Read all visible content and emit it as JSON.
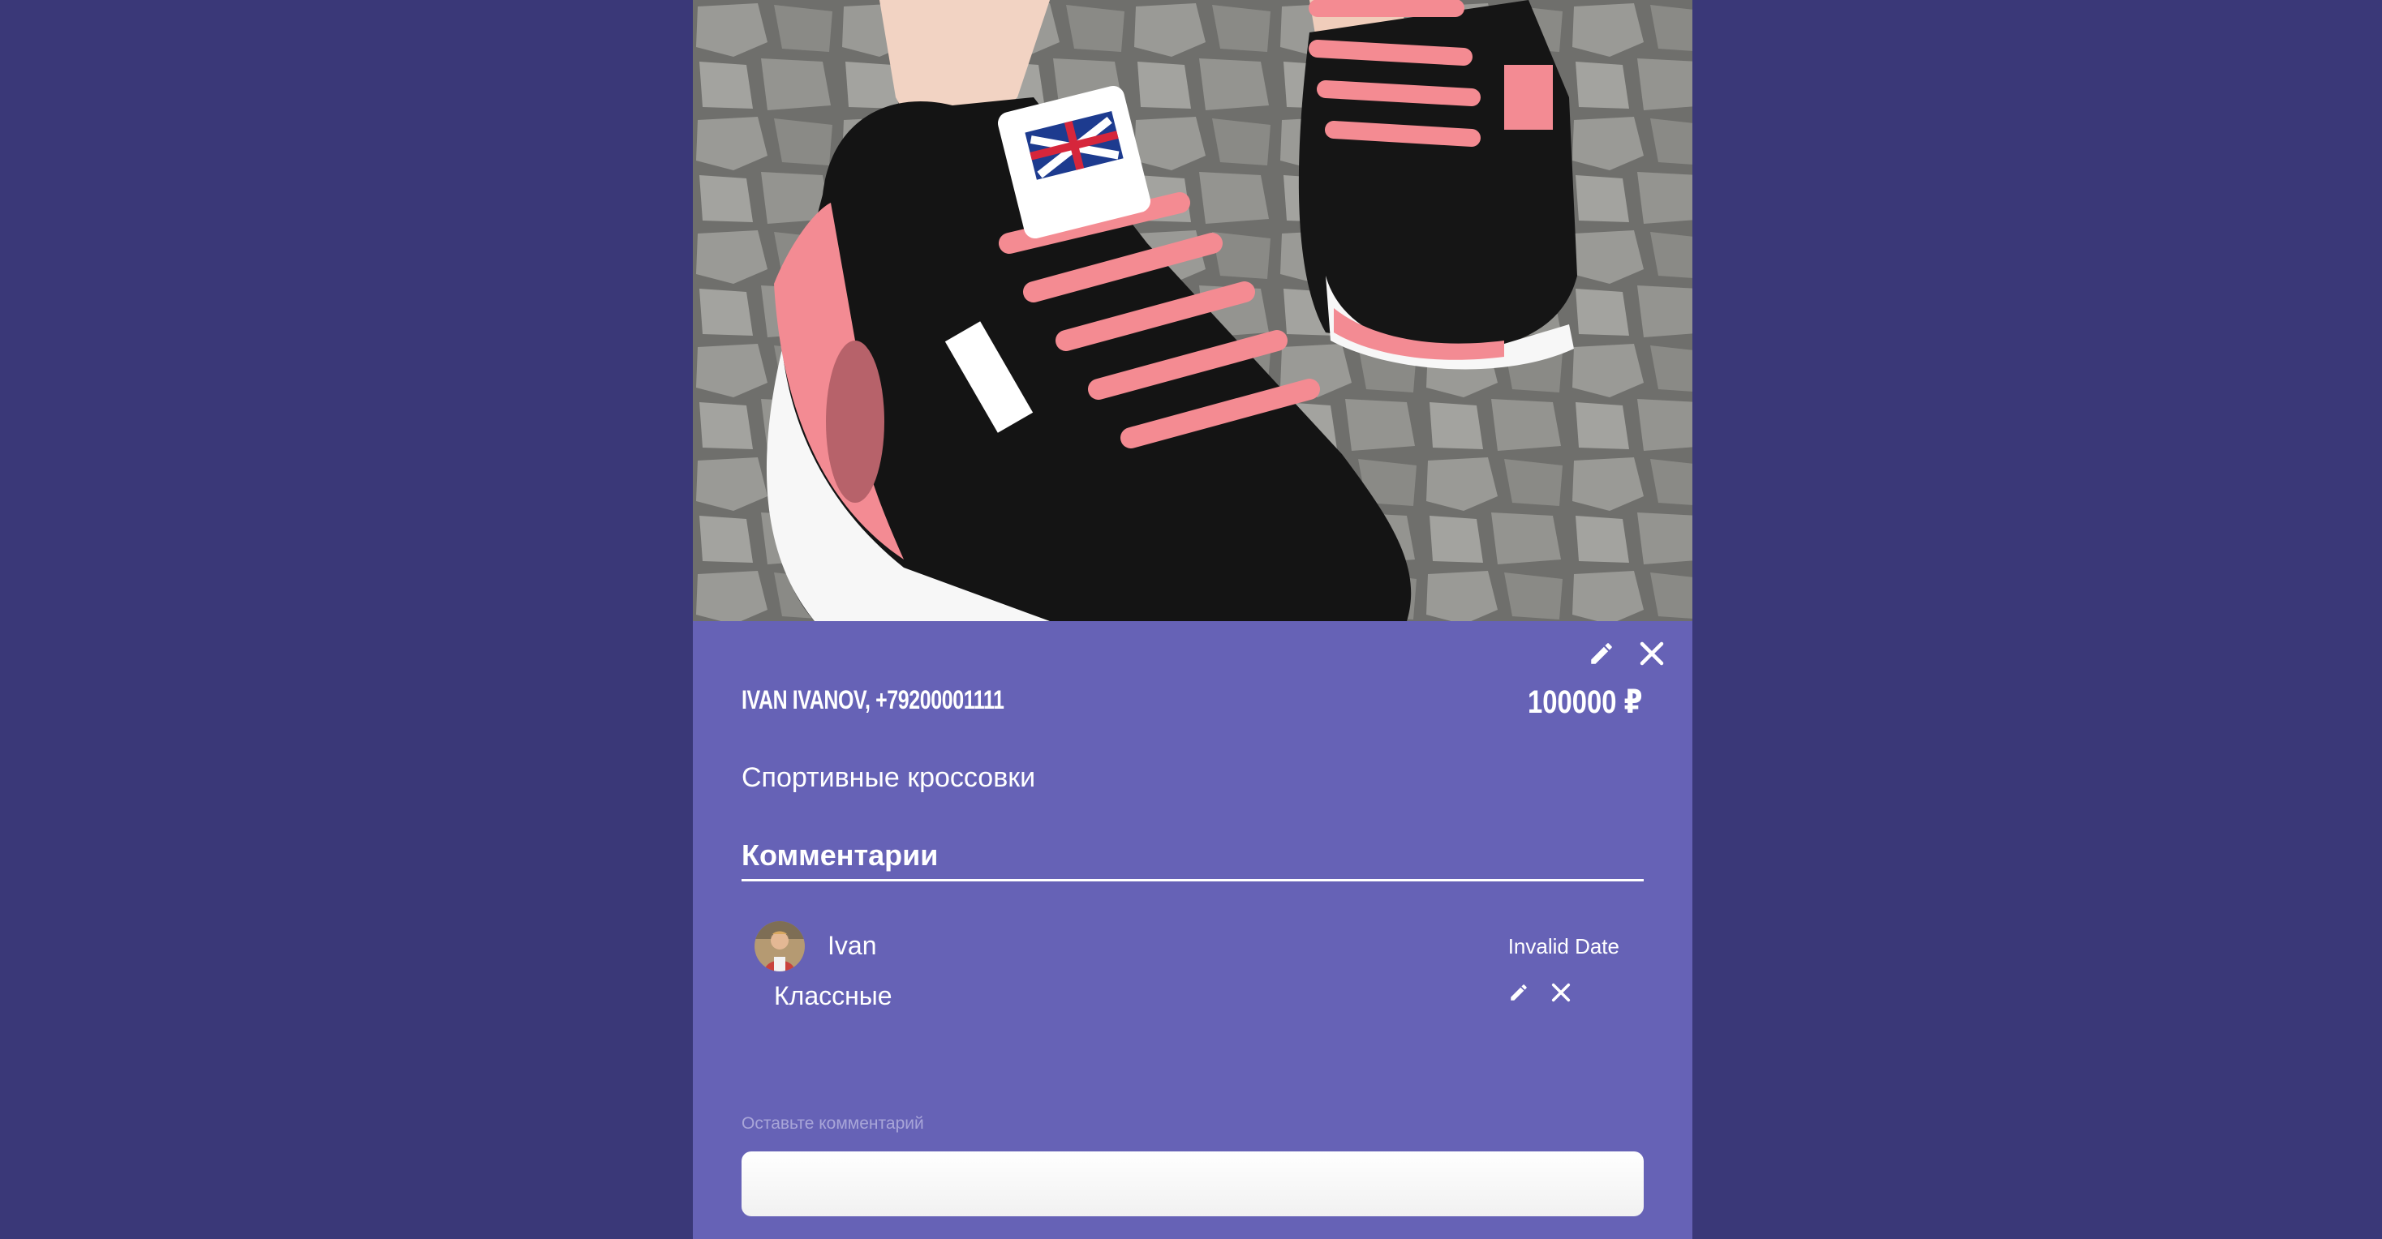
{
  "listing": {
    "photo_alt": "pink-black-sneakers-photo",
    "seller": "IVAN IVANOV, +79200001111",
    "price": "100000 ₽",
    "title": "Спортивные кроссовки"
  },
  "comments": {
    "heading": "Комментарии",
    "items": [
      {
        "author": "Ivan",
        "date": "Invalid Date",
        "text": "Классные"
      }
    ],
    "input_label": "Оставьте комментарий",
    "input_value": ""
  },
  "icons": {
    "edit": "pencil-icon",
    "delete": "close-icon"
  },
  "colors": {
    "page_background": "#3a3878",
    "card_background": "#6662b6",
    "text": "#ffffff",
    "input_label": "#a8a5d8"
  }
}
